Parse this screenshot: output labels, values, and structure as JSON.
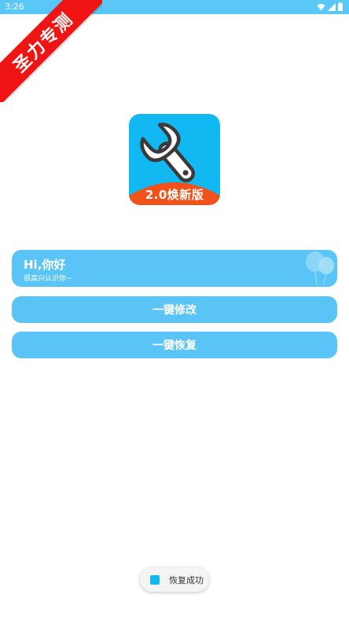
{
  "status_bar": {
    "time": "3:26",
    "icons": [
      "wifi-icon",
      "signal-icon",
      "battery-icon"
    ]
  },
  "ribbon": {
    "text": "圣力专测"
  },
  "app_icon": {
    "label": "2.0焕新版",
    "icon": "wrench-icon"
  },
  "hello_card": {
    "title": "Hi,你好",
    "subtitle": "很高兴认识你~"
  },
  "buttons": {
    "modify": "一键修改",
    "restore": "一键恢复"
  },
  "toast": {
    "text": "恢复成功"
  },
  "colors": {
    "accent": "#5ac4f6",
    "status_bar": "#5ac8f6",
    "ribbon": "#f01515",
    "icon_bg": "#12b8f1",
    "icon_banner": "#f0521a"
  }
}
